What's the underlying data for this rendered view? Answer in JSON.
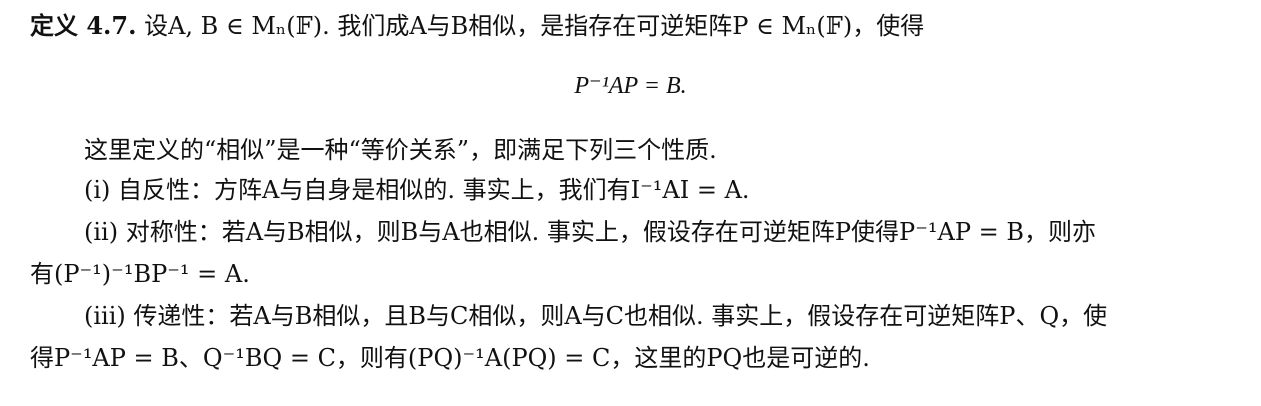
{
  "definition": {
    "label": "定义 4.7.",
    "line1": " 设A, B ∈ Mₙ(𝔽). 我们成A与B相似，是指存在可逆矩阵P ∈ Mₙ(𝔽)，使得",
    "equation": "P⁻¹AP = B."
  },
  "intro": "这里定义的“相似”是一种“等价关系”，即满足下列三个性质.",
  "properties": [
    {
      "line1": "(i) 自反性：方阵A与自身是相似的. 事实上，我们有I⁻¹AI = A."
    },
    {
      "line1": "(ii) 对称性：若A与B相似，则B与A也相似. 事实上，假设存在可逆矩阵P使得P⁻¹AP = B，则亦",
      "line2": "有(P⁻¹)⁻¹BP⁻¹ = A."
    },
    {
      "line1": "(iii) 传递性：若A与B相似，且B与C相似，则A与C也相似. 事实上，假设存在可逆矩阵P、Q，使",
      "line2": "得P⁻¹AP = B、Q⁻¹BQ = C，则有(PQ)⁻¹A(PQ) = C，这里的PQ也是可逆的."
    }
  ]
}
